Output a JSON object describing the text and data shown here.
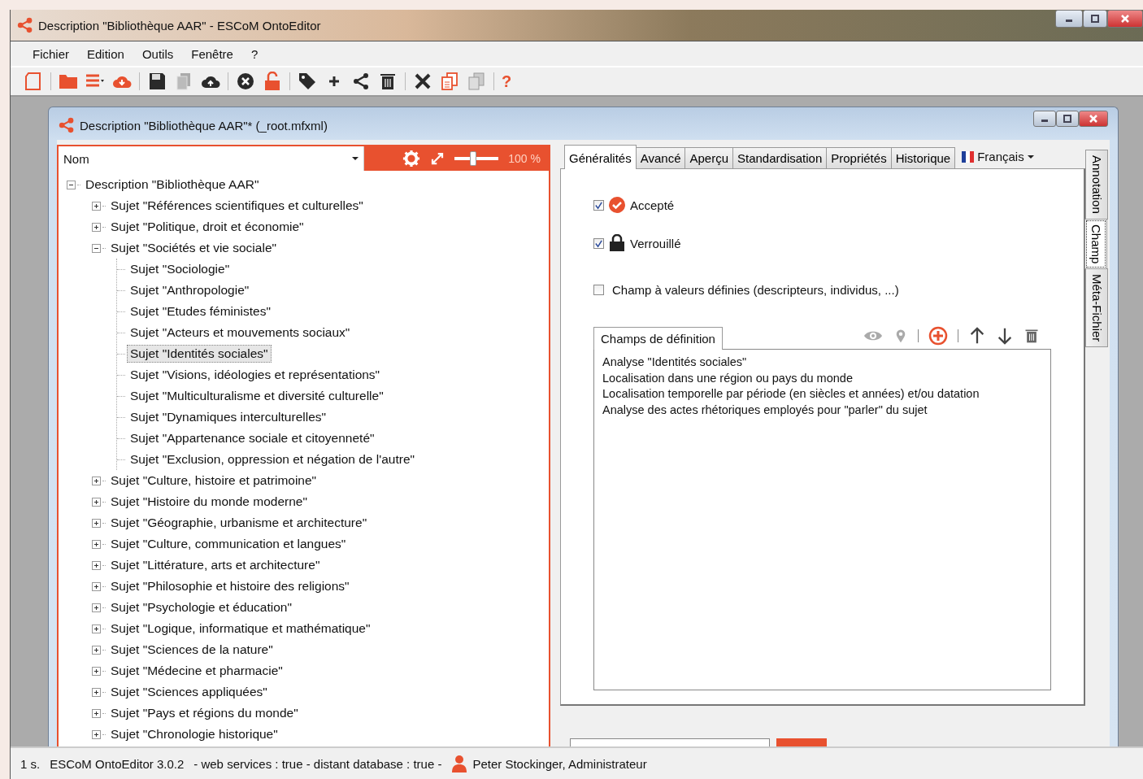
{
  "window": {
    "title": "Description \"Bibliothèque AAR\" - ESCoM OntoEditor"
  },
  "menu": [
    "Fichier",
    "Edition",
    "Outils",
    "Fenêtre",
    "?"
  ],
  "toolbar": {
    "help_label": "?"
  },
  "document": {
    "title": "Description \"Bibliothèque AAR\"* (_root.mfxml)",
    "name_field": {
      "value": "Nom"
    },
    "zoom": {
      "level": 0.4,
      "reading": "100 %"
    },
    "tree": {
      "label": "Description \"Bibliothèque AAR\"",
      "expanded": true,
      "selected": false,
      "children": [
        {
          "label": "Sujet \"Références scientifiques et culturelles\"",
          "expanded": false,
          "selected": false
        },
        {
          "label": "Sujet \"Politique, droit et économie\"",
          "expanded": false,
          "selected": false
        },
        {
          "label": "Sujet \"Sociétés et vie sociale\"",
          "expanded": true,
          "selected": false,
          "children": [
            {
              "label": "Sujet \"Sociologie\"",
              "selected": false
            },
            {
              "label": "Sujet \"Anthropologie\"",
              "selected": false
            },
            {
              "label": "Sujet \"Etudes féministes\"",
              "selected": false
            },
            {
              "label": "Sujet \"Acteurs et mouvements sociaux\"",
              "selected": false
            },
            {
              "label": "Sujet \"Identités sociales\"",
              "selected": true
            },
            {
              "label": "Sujet \"Visions, idéologies et représentations\"",
              "selected": false
            },
            {
              "label": "Sujet \"Multiculturalisme et diversité culturelle\"",
              "selected": false
            },
            {
              "label": "Sujet \"Dynamiques interculturelles\"",
              "selected": false
            },
            {
              "label": "Sujet \"Appartenance sociale et citoyenneté\"",
              "selected": false
            },
            {
              "label": "Sujet \"Exclusion, oppression et négation de l'autre\"",
              "selected": false
            }
          ]
        },
        {
          "label": "Sujet \"Culture, histoire et patrimoine\"",
          "expanded": false,
          "selected": false
        },
        {
          "label": "Sujet \"Histoire du monde moderne\"",
          "expanded": false,
          "selected": false
        },
        {
          "label": "Sujet \"Géographie, urbanisme et architecture\"",
          "expanded": false,
          "selected": false
        },
        {
          "label": "Sujet \"Culture, communication et langues\"",
          "expanded": false,
          "selected": false
        },
        {
          "label": "Sujet \"Littérature, arts et architecture\"",
          "expanded": false,
          "selected": false
        },
        {
          "label": "Sujet \"Philosophie et histoire des religions\"",
          "expanded": false,
          "selected": false
        },
        {
          "label": "Sujet \"Psychologie et éducation\"",
          "expanded": false,
          "selected": false
        },
        {
          "label": "Sujet \"Logique, informatique et mathématique\"",
          "expanded": false,
          "selected": false
        },
        {
          "label": "Sujet \"Sciences de la nature\"",
          "expanded": false,
          "selected": false
        },
        {
          "label": "Sujet \"Médecine et pharmacie\"",
          "expanded": false,
          "selected": false
        },
        {
          "label": "Sujet \"Sciences appliquées\"",
          "expanded": false,
          "selected": false
        },
        {
          "label": "Sujet \"Pays et régions du monde\"",
          "expanded": false,
          "selected": false
        },
        {
          "label": "Sujet \"Chronologie historique\"",
          "expanded": false,
          "selected": false
        }
      ]
    }
  },
  "properties": {
    "tabs": [
      {
        "label": "Généralités",
        "selected": true
      },
      {
        "label": "Avancé",
        "selected": false
      },
      {
        "label": "Aperçu",
        "selected": false
      },
      {
        "label": "Standardisation",
        "selected": false
      },
      {
        "label": "Propriétés",
        "selected": false
      },
      {
        "label": "Historique",
        "selected": false
      }
    ],
    "language": "Français",
    "options": [
      {
        "kind": "accepted",
        "label": "Accepté",
        "checked": true
      },
      {
        "kind": "locked",
        "label": "Verrouillé",
        "checked": true
      },
      {
        "kind": "plain",
        "label": "Champ à valeurs définies (descripteurs, individus, ...)",
        "checked": false
      }
    ],
    "definition": {
      "tab_label": "Champs de définition",
      "lines": [
        "Analyse \"Identités sociales\"",
        "Localisation dans une région ou pays du monde",
        "Localisation temporelle par période (en siècles et années) et/ou datation",
        "Analyse des actes rhétoriques employés pour \"parler\" du sujet"
      ]
    }
  },
  "side_tabs": [
    {
      "label": "Annotation",
      "selected": false
    },
    {
      "label": "Champ",
      "selected": true
    },
    {
      "label": "Méta-Fichier",
      "selected": false
    }
  ],
  "status_bar": {
    "time": "1 s.",
    "app": "ESCoM OntoEditor 3.0.2",
    "info": "-  web services : true - distant database : true -",
    "user": "Peter Stockinger, Administrateur"
  }
}
